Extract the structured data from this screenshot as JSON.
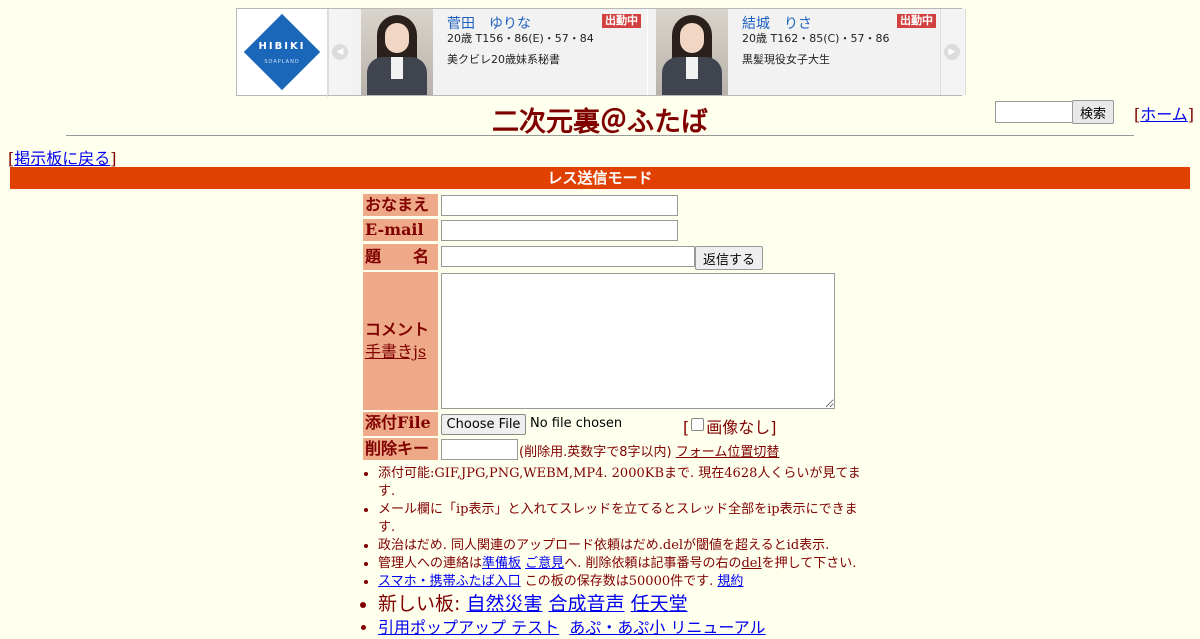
{
  "banner": {
    "logo": {
      "text": "HIBIKI",
      "sub": "SOAPLAND"
    },
    "prev_arrow": "◀",
    "next_arrow": "▶",
    "cards": [
      {
        "name": "菅田　ゆりな",
        "badge": "出勤中",
        "stats": "20歳 T156・86(E)・57・84",
        "desc": "美クビレ20歳妹系秘書"
      },
      {
        "name": "結城　りさ",
        "badge": "出勤中",
        "stats": "20歳 T162・85(C)・57・86",
        "desc": "黒髪現役女子大生"
      }
    ]
  },
  "header": {
    "title": "二次元裏＠ふたば",
    "search_button": "検索",
    "search_value": "",
    "home_link": "ホーム",
    "back_link": "掲示板に戻る"
  },
  "mode_bar": "レス送信モード",
  "form": {
    "name_label": "おなまえ",
    "email_label": "E-mail",
    "subject_label": "題　　名",
    "submit_button": "返信する",
    "comment_label": "コメント",
    "handwriting_link": "手書きjs",
    "file_label": "添付File",
    "file_button": "Choose File",
    "file_status": "No file chosen",
    "no_image_label": "画像なし",
    "delkey_label": "削除キー",
    "delkey_note": "(削除用.英数字で8字以内)",
    "form_toggle_link": "フォーム位置切替"
  },
  "notes": {
    "n1": "添付可能:GIF,JPG,PNG,WEBM,MP4. 2000KBまで. 現在4628人くらいが見てます.",
    "n2": "メール欄に「ip表示」と入れてスレッドを立てるとスレッド全部をip表示にできます.",
    "n3": "政治はだめ. 同人関連のアップロード依頼はだめ.delが閾値を超えるとid表示.",
    "n4_pre": "管理人への連絡は",
    "n4_link1": "準備板",
    "n4_link2": "ご意見",
    "n4_mid": "へ. 削除依頼は記事番号の右の",
    "n4_del": "del",
    "n4_post": "を押して下さい.",
    "n5_link": "スマホ・携帯ふたば入口",
    "n5_mid": " この板の保存数は50000件です.",
    "n5_rules": "規約",
    "new_boards_label": "新しい板: ",
    "new_boards": [
      "自然災害",
      "合成音声",
      "任天堂"
    ],
    "link_popup": "引用ポップアップ テスト",
    "link_renewal": "あぷ・あぷ小 リニューアル"
  }
}
